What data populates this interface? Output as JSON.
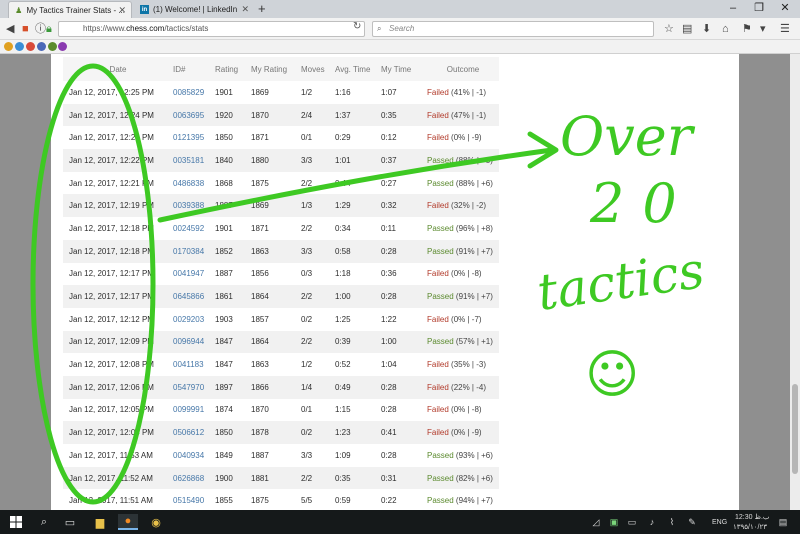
{
  "browser": {
    "tabs": [
      {
        "title": "My Tactics Trainer Stats - ...",
        "active": true
      },
      {
        "title": "(1) Welcome! | LinkedIn",
        "active": false
      }
    ],
    "url_prefix": "https://www.",
    "url_site": "chess.com",
    "url_path": "/tactics/stats",
    "search_placeholder": "Search"
  },
  "table": {
    "headers": [
      "Date",
      "ID#",
      "Rating",
      "My Rating",
      "Moves",
      "Avg. Time",
      "My Time",
      "Outcome"
    ],
    "rows": [
      {
        "date": "Jan 12, 2017, 12:25 PM",
        "id": "0085829",
        "rating": "1901",
        "my_rating": "1869",
        "moves": "1/2",
        "avg_time": "1:16",
        "my_time": "1:07",
        "status": "Failed",
        "detail": "(41% | -1)"
      },
      {
        "date": "Jan 12, 2017, 12:24 PM",
        "id": "0063695",
        "rating": "1920",
        "my_rating": "1870",
        "moves": "2/4",
        "avg_time": "1:37",
        "my_time": "0:35",
        "status": "Failed",
        "detail": "(47% | -1)"
      },
      {
        "date": "Jan 12, 2017, 12:22 PM",
        "id": "0121395",
        "rating": "1850",
        "my_rating": "1871",
        "moves": "0/1",
        "avg_time": "0:29",
        "my_time": "0:12",
        "status": "Failed",
        "detail": "(0% | -9)"
      },
      {
        "date": "Jan 12, 2017, 12:22 PM",
        "id": "0035181",
        "rating": "1840",
        "my_rating": "1880",
        "moves": "3/3",
        "avg_time": "1:01",
        "my_time": "0:37",
        "status": "Passed",
        "detail": "(88% | +5)"
      },
      {
        "date": "Jan 12, 2017, 12:21 PM",
        "id": "0486838",
        "rating": "1868",
        "my_rating": "1875",
        "moves": "2/2",
        "avg_time": "0:44",
        "my_time": "0:27",
        "status": "Passed",
        "detail": "(88% | +6)"
      },
      {
        "date": "Jan 12, 2017, 12:19 PM",
        "id": "0039388",
        "rating": "1887",
        "my_rating": "1869",
        "moves": "1/3",
        "avg_time": "1:29",
        "my_time": "0:32",
        "status": "Failed",
        "detail": "(32% | -2)"
      },
      {
        "date": "Jan 12, 2017, 12:18 PM",
        "id": "0024592",
        "rating": "1901",
        "my_rating": "1871",
        "moves": "2/2",
        "avg_time": "0:34",
        "my_time": "0:11",
        "status": "Passed",
        "detail": "(96% | +8)"
      },
      {
        "date": "Jan 12, 2017, 12:18 PM",
        "id": "0170384",
        "rating": "1852",
        "my_rating": "1863",
        "moves": "3/3",
        "avg_time": "0:58",
        "my_time": "0:28",
        "status": "Passed",
        "detail": "(91% | +7)"
      },
      {
        "date": "Jan 12, 2017, 12:17 PM",
        "id": "0041947",
        "rating": "1887",
        "my_rating": "1856",
        "moves": "0/3",
        "avg_time": "1:18",
        "my_time": "0:36",
        "status": "Failed",
        "detail": "(0% | -8)"
      },
      {
        "date": "Jan 12, 2017, 12:17 PM",
        "id": "0645866",
        "rating": "1861",
        "my_rating": "1864",
        "moves": "2/2",
        "avg_time": "1:00",
        "my_time": "0:28",
        "status": "Passed",
        "detail": "(91% | +7)"
      },
      {
        "date": "Jan 12, 2017, 12:12 PM",
        "id": "0029203",
        "rating": "1903",
        "my_rating": "1857",
        "moves": "0/2",
        "avg_time": "1:25",
        "my_time": "1:22",
        "status": "Failed",
        "detail": "(0% | -7)"
      },
      {
        "date": "Jan 12, 2017, 12:09 PM",
        "id": "0096944",
        "rating": "1847",
        "my_rating": "1864",
        "moves": "2/2",
        "avg_time": "0:39",
        "my_time": "1:00",
        "status": "Passed",
        "detail": "(57% | +1)"
      },
      {
        "date": "Jan 12, 2017, 12:08 PM",
        "id": "0041183",
        "rating": "1847",
        "my_rating": "1863",
        "moves": "1/2",
        "avg_time": "0:52",
        "my_time": "1:04",
        "status": "Failed",
        "detail": "(35% | -3)"
      },
      {
        "date": "Jan 12, 2017, 12:06 PM",
        "id": "0547970",
        "rating": "1897",
        "my_rating": "1866",
        "moves": "1/4",
        "avg_time": "0:49",
        "my_time": "0:28",
        "status": "Failed",
        "detail": "(22% | -4)"
      },
      {
        "date": "Jan 12, 2017, 12:05 PM",
        "id": "0099991",
        "rating": "1874",
        "my_rating": "1870",
        "moves": "0/1",
        "avg_time": "1:15",
        "my_time": "0:28",
        "status": "Failed",
        "detail": "(0% | -8)"
      },
      {
        "date": "Jan 12, 2017, 12:04 PM",
        "id": "0506612",
        "rating": "1850",
        "my_rating": "1878",
        "moves": "0/2",
        "avg_time": "1:23",
        "my_time": "0:41",
        "status": "Failed",
        "detail": "(0% | -9)"
      },
      {
        "date": "Jan 12, 2017, 11:53 AM",
        "id": "0040934",
        "rating": "1849",
        "my_rating": "1887",
        "moves": "3/3",
        "avg_time": "1:09",
        "my_time": "0:28",
        "status": "Passed",
        "detail": "(93% | +6)"
      },
      {
        "date": "Jan 12, 2017, 11:52 AM",
        "id": "0626868",
        "rating": "1900",
        "my_rating": "1881",
        "moves": "2/2",
        "avg_time": "0:35",
        "my_time": "0:31",
        "status": "Passed",
        "detail": "(82% | +6)"
      },
      {
        "date": "Jan 12, 2017, 11:51 AM",
        "id": "0515490",
        "rating": "1855",
        "my_rating": "1875",
        "moves": "5/5",
        "avg_time": "0:59",
        "my_time": "0:22",
        "status": "Passed",
        "detail": "(94% | +7)"
      }
    ]
  },
  "annotation": {
    "line1": "Over",
    "line2": "20",
    "line3": "tactics",
    "smiley": "☺",
    "color": "#3ec923"
  },
  "taskbar": {
    "language": "ENG",
    "clock_time": "12:30 ب.ظ",
    "clock_date": "۱۳۹۵/۱۰/۲۳"
  },
  "colors": {
    "failed": "#b23b2b",
    "passed": "#5b8a2e",
    "id_link": "#4677a8"
  }
}
